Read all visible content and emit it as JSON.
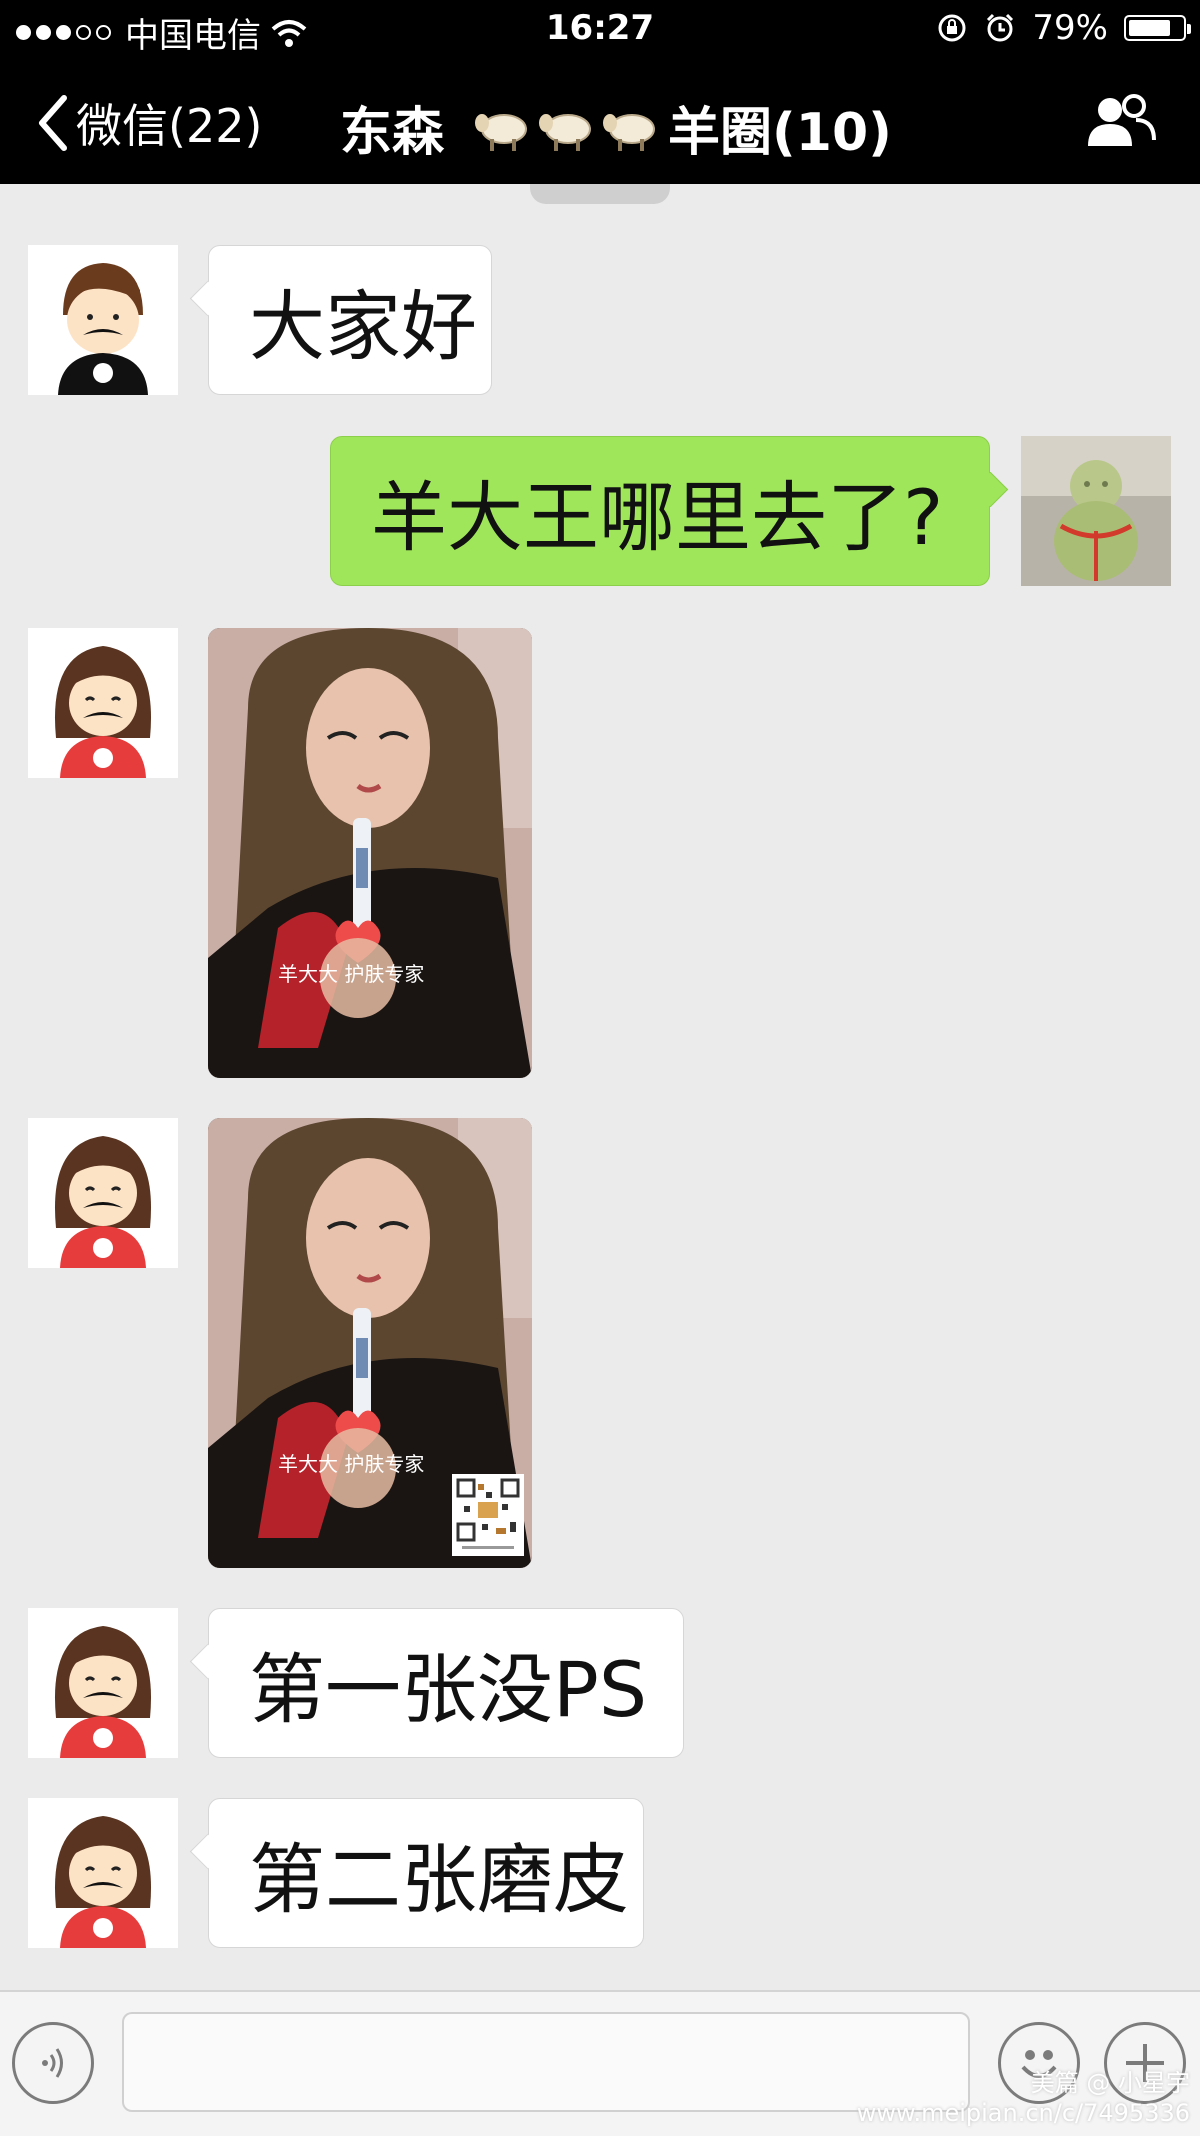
{
  "status_bar": {
    "carrier": "中国电信",
    "time": "16:27",
    "battery_text": "79%",
    "battery_level": 0.79
  },
  "nav": {
    "back_label": "微信(22)",
    "title_name": "东森",
    "title_group": "羊圈(10)",
    "right_icon": "group-members-icon"
  },
  "messages": [
    {
      "side": "left",
      "type": "text",
      "text": "大家好"
    },
    {
      "side": "right",
      "type": "text",
      "text": "羊大王哪里去了?"
    },
    {
      "side": "left",
      "type": "image",
      "caption": "羊大大 护肤专家"
    },
    {
      "side": "left",
      "type": "image",
      "caption": "羊大大 护肤专家"
    },
    {
      "side": "left",
      "type": "text",
      "text": "第一张没PS"
    },
    {
      "side": "left",
      "type": "text",
      "text": "第二张磨皮"
    }
  ],
  "input_bar": {
    "value": "",
    "voice_icon": "voice-icon",
    "emoji_icon": "emoji-icon",
    "plus_icon": "plus-icon"
  },
  "watermark": {
    "line1": "美篇 @ 小星宇",
    "line2": "www.meipian.cn/c/7495336"
  },
  "colors": {
    "background": "#ebebeb",
    "header": "#000000",
    "sent_bubble": "#9fe65a",
    "received_bubble": "#ffffff"
  }
}
